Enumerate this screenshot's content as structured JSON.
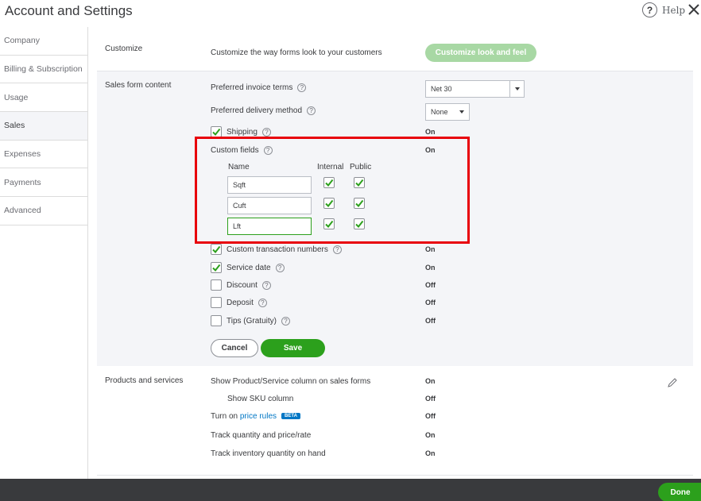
{
  "header": {
    "title": "Account and Settings",
    "help_label": "Help",
    "help_glyph": "?"
  },
  "sidebar": {
    "items": [
      {
        "label": "Company"
      },
      {
        "label": "Billing & Subscription"
      },
      {
        "label": "Usage"
      },
      {
        "label": "Sales"
      },
      {
        "label": "Expenses"
      },
      {
        "label": "Payments"
      },
      {
        "label": "Advanced"
      }
    ],
    "active": "Sales"
  },
  "customize": {
    "section": "Customize",
    "description": "Customize the way forms look to your customers",
    "button": "Customize look and feel"
  },
  "sales_form": {
    "section": "Sales form content",
    "invoice_terms_label": "Preferred invoice terms",
    "invoice_terms_value": "Net 30",
    "delivery_label": "Preferred delivery method",
    "delivery_value": "None",
    "shipping_label": "Shipping",
    "shipping_status": "On",
    "custom_fields_label": "Custom fields",
    "custom_fields_status": "On",
    "cf_headers": {
      "name": "Name",
      "internal": "Internal",
      "public": "Public"
    },
    "cf_rows": [
      {
        "name": "Sqft",
        "internal": true,
        "public": true
      },
      {
        "name": "Cuft",
        "internal": true,
        "public": true
      },
      {
        "name": "Lft",
        "internal": true,
        "public": true
      }
    ],
    "options": [
      {
        "label": "Custom transaction numbers",
        "checked": true,
        "status": "On"
      },
      {
        "label": "Service date",
        "checked": true,
        "status": "On"
      },
      {
        "label": "Discount",
        "checked": false,
        "status": "Off"
      },
      {
        "label": "Deposit",
        "checked": false,
        "status": "Off"
      },
      {
        "label": "Tips (Gratuity)",
        "checked": false,
        "status": "Off"
      }
    ],
    "cancel": "Cancel",
    "save": "Save"
  },
  "products": {
    "section": "Products and services",
    "rows": [
      {
        "label": "Show Product/Service column on sales forms",
        "status": "On"
      },
      {
        "label": "Show SKU column",
        "status": "Off"
      },
      {
        "label_prefix": "Turn on",
        "link": "price rules",
        "badge": "BETA",
        "status": "Off"
      },
      {
        "label": "Track quantity and price/rate",
        "status": "On"
      },
      {
        "label": "Track inventory quantity on hand",
        "status": "On"
      }
    ]
  },
  "footer": {
    "done": "Done"
  },
  "colors": {
    "green": "#2ca01c",
    "light_green": "#a8d8a4",
    "red_box": "#e8000b",
    "link": "#0077c5",
    "footer": "#393a3d"
  },
  "icons": [
    "help-icon",
    "close-icon",
    "question-icon",
    "checkbox-check-icon",
    "dropdown-arrow-icon",
    "pencil-icon"
  ]
}
